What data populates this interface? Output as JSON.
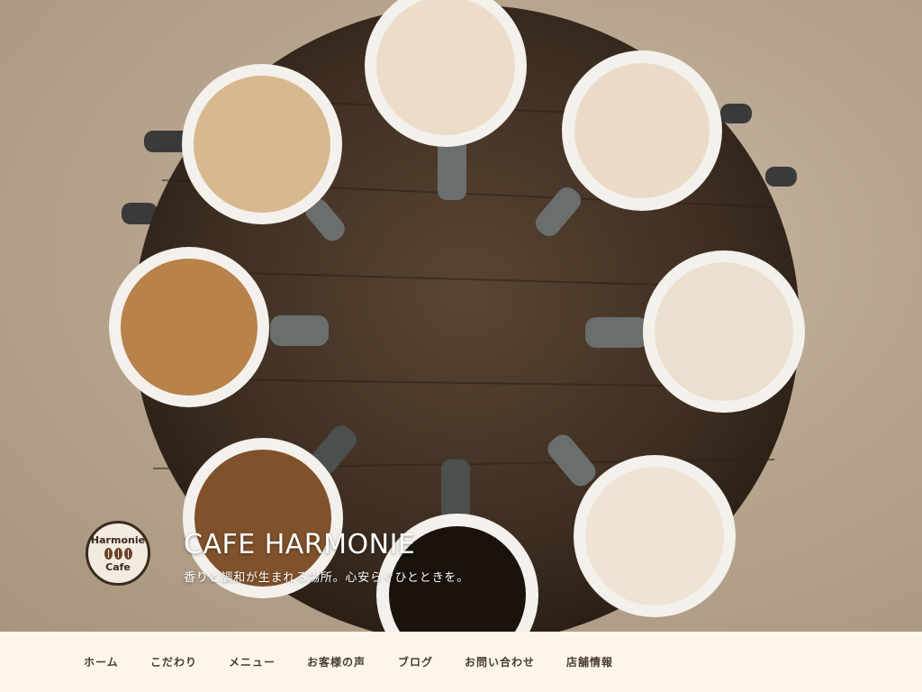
{
  "site": {
    "title": "CAFE HARMONIE",
    "tagline": "香りと調和が生まれる場所。心安らぐひとときを。",
    "logo_top": "Harmonie",
    "logo_bottom": "Cafe"
  },
  "nav": {
    "items": [
      {
        "label": "ホーム"
      },
      {
        "label": "こだわり"
      },
      {
        "label": "メニュー"
      },
      {
        "label": "お客様の声"
      },
      {
        "label": "ブログ"
      },
      {
        "label": "お問い合わせ"
      },
      {
        "label": "店舗情報"
      }
    ]
  },
  "colors": {
    "nav_background": "#fbf6e8",
    "nav_text": "#4a3b30",
    "title_text": "#ffffff"
  }
}
